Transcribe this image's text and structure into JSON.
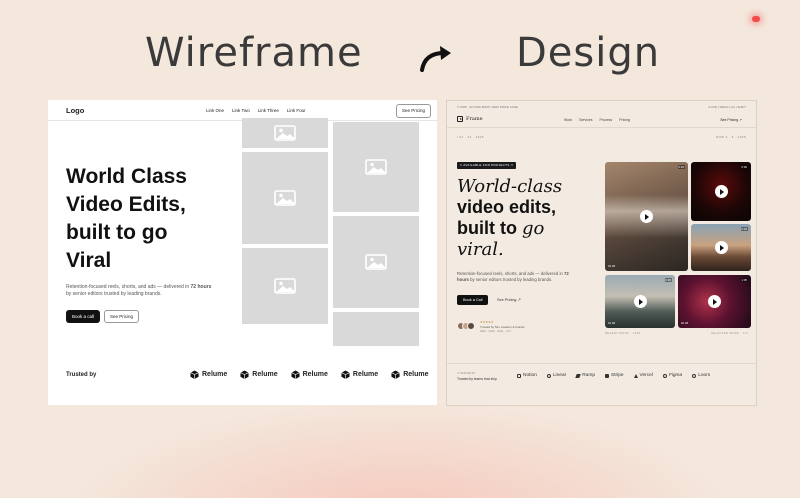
{
  "headings": {
    "left": "Wireframe",
    "right": "Design"
  },
  "wireframe": {
    "logo": "Logo",
    "nav_links": [
      "Link One",
      "Link Two",
      "Link Three",
      "Link Four"
    ],
    "pricing_button": "See Pricing",
    "title": "World Class Video Edits, built to go Viral",
    "subtitle_pre": "Retention-focused reels, shorts, and ads — delivered in ",
    "subtitle_bold": "72 hours",
    "subtitle_post": " by senior editors trusted by leading brands.",
    "primary_button": "Book a call",
    "secondary_button": "See Pricing",
    "trusted_label": "Trusted by",
    "trusted_logos": [
      "Relume",
      "Relume",
      "Relume",
      "Relume",
      "Relume"
    ]
  },
  "design": {
    "topbar_left": "© 2025 · 02   NOW   BOOK   VIEW   PRICE   CASE",
    "topbar_right": "4 LIVE  |  WRLD  |  AU  |  SHIFT",
    "brand": "Frame",
    "nav_links": [
      "Work",
      "Services",
      "Process",
      "Pricing"
    ],
    "pricing_link": "See Pricing ↗",
    "meta_left": "/ 01 · 01 · 2025",
    "meta_right": "NOW 4 · 4 · 2025",
    "badge": "// AVAILABLE FOR PROJECTS //",
    "title_line1": "World-class",
    "title_line2": "video edits,",
    "title_line3_bold": "built to ",
    "title_line3_italic": "go",
    "title_line4": "viral.",
    "subtitle_pre": "Retention-focused reels, shorts, and ads — delivered in ",
    "subtitle_bold": "72 hours",
    "subtitle_post": " by senior editors trusted by leading brands.",
    "primary_button": "Book a Call",
    "secondary_button": "See Pricing  ↗",
    "stars": "★★★★★",
    "trust_text": "Trusted by 50+ creators & brands",
    "trust_sub": "REEL · REEL · REEL · 24H",
    "tile_caption_left": "RECENT WORK · 2025",
    "tile_caption_right": "SELECTED WORK · 4/4",
    "tiles": [
      {
        "duration": "0:24",
        "tag": "01 48"
      },
      {
        "duration": "0:30",
        "tag": ""
      },
      {
        "duration": "0:18",
        "tag": ""
      },
      {
        "duration": "0:36",
        "tag": "01 48"
      },
      {
        "duration": "1:05",
        "tag": "02 48"
      }
    ],
    "trusted_label_small": "// TRUSTED BY",
    "trusted_label": "Trusted by teams that ship",
    "trusted_logos": [
      "Notion",
      "Linear",
      "Ramp",
      "Stripe",
      "Vercel",
      "Figma",
      "Loom"
    ]
  },
  "colors": {
    "background": "#f4e7dc",
    "design_bg": "#f3ebe1",
    "accent_dot": "#f24a4a"
  }
}
